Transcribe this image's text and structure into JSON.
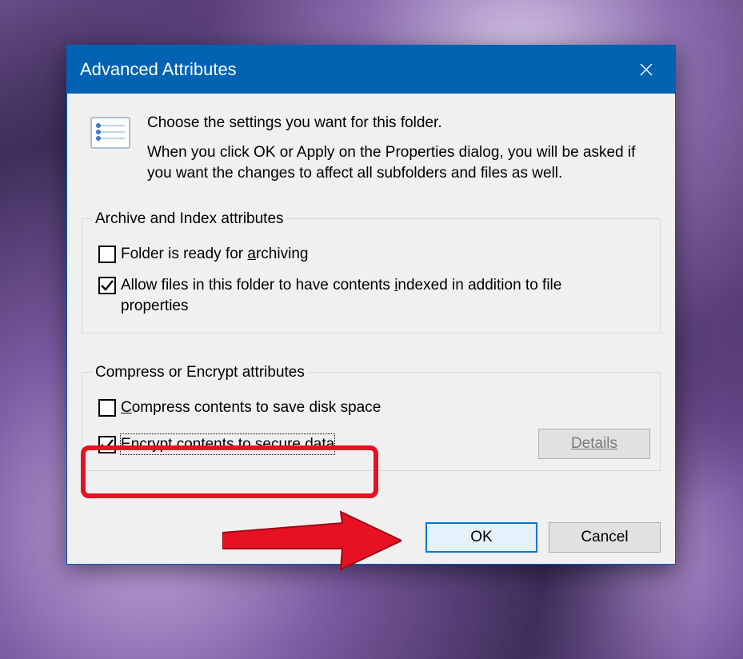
{
  "dialog": {
    "title": "Advanced Attributes",
    "intro_line1": "Choose the settings you want for this folder.",
    "intro_line2": "When you click OK or Apply on the Properties dialog, you will be asked if you want the changes to affect all subfolders and files as well."
  },
  "group1": {
    "legend": "Archive and Index attributes",
    "archive": {
      "checked": false,
      "label_pre": "Folder is ready for ",
      "accel": "a",
      "label_post": "rchiving"
    },
    "index": {
      "checked": true,
      "label_pre": "Allow files in this folder to have contents ",
      "accel": "i",
      "label_post": "ndexed in addition to file properties"
    }
  },
  "group2": {
    "legend": "Compress or Encrypt attributes",
    "compress": {
      "checked": false,
      "label_accel": "C",
      "label_rest": "ompress contents to save disk space"
    },
    "encrypt": {
      "checked": true,
      "label_accel": "E",
      "label_rest": "ncrypt contents to secure data"
    },
    "details_label": "Details"
  },
  "buttons": {
    "ok": "OK",
    "cancel": "Cancel"
  }
}
